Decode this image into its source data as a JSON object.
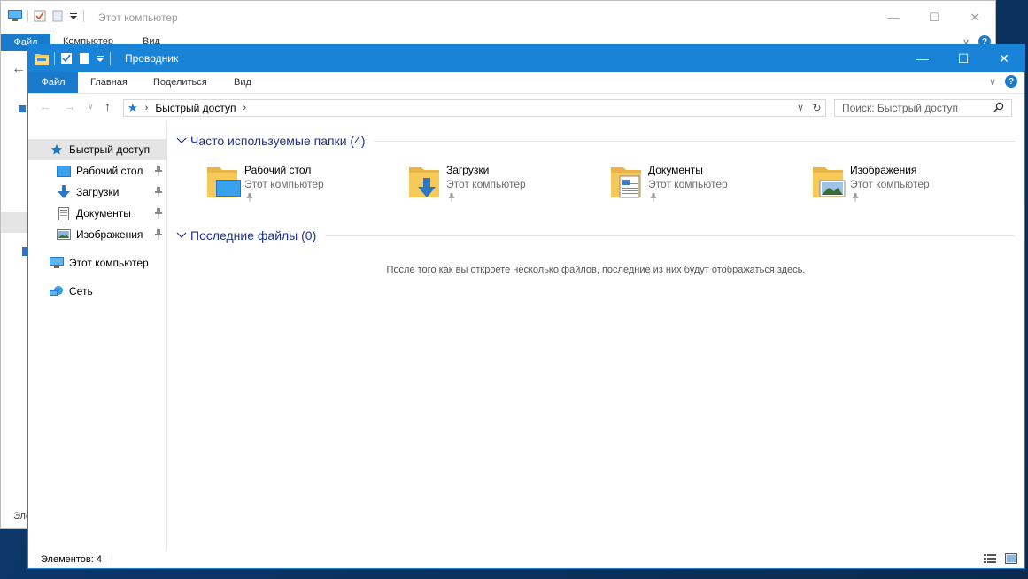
{
  "background_window": {
    "title": "Этот компьютер",
    "tabs": {
      "file": "Файл",
      "computer": "Компьютер",
      "view": "Вид"
    },
    "status_fragment": "Эле"
  },
  "window": {
    "title": "Проводник",
    "tabs": {
      "file": "Файл",
      "home": "Главная",
      "share": "Поделиться",
      "view": "Вид"
    },
    "address": {
      "crumb": "Быстрый доступ"
    },
    "search": {
      "placeholder": "Поиск: Быстрый доступ"
    },
    "nav_pane": {
      "quick_access": "Быстрый доступ",
      "desktop": "Рабочий стол",
      "downloads": "Загрузки",
      "documents": "Документы",
      "pictures": "Изображения",
      "this_pc": "Этот компьютер",
      "network": "Сеть"
    },
    "frequent": {
      "header": "Часто используемые папки (4)",
      "items": [
        {
          "name": "Рабочий стол",
          "location": "Этот компьютер",
          "icon": "desktop-folder-icon"
        },
        {
          "name": "Загрузки",
          "location": "Этот компьютер",
          "icon": "downloads-folder-icon"
        },
        {
          "name": "Документы",
          "location": "Этот компьютер",
          "icon": "documents-folder-icon"
        },
        {
          "name": "Изображения",
          "location": "Этот компьютер",
          "icon": "pictures-folder-icon"
        }
      ]
    },
    "recent": {
      "header": "Последние файлы (0)",
      "empty_message": "После того как вы откроете несколько файлов, последние из них будут отображаться здесь."
    },
    "status": {
      "items_count": "Элементов: 4"
    },
    "colors": {
      "accent": "#1883d7",
      "file_tab": "#1979ca",
      "group_header": "#1e3287",
      "folder": "#f6c95a"
    }
  }
}
